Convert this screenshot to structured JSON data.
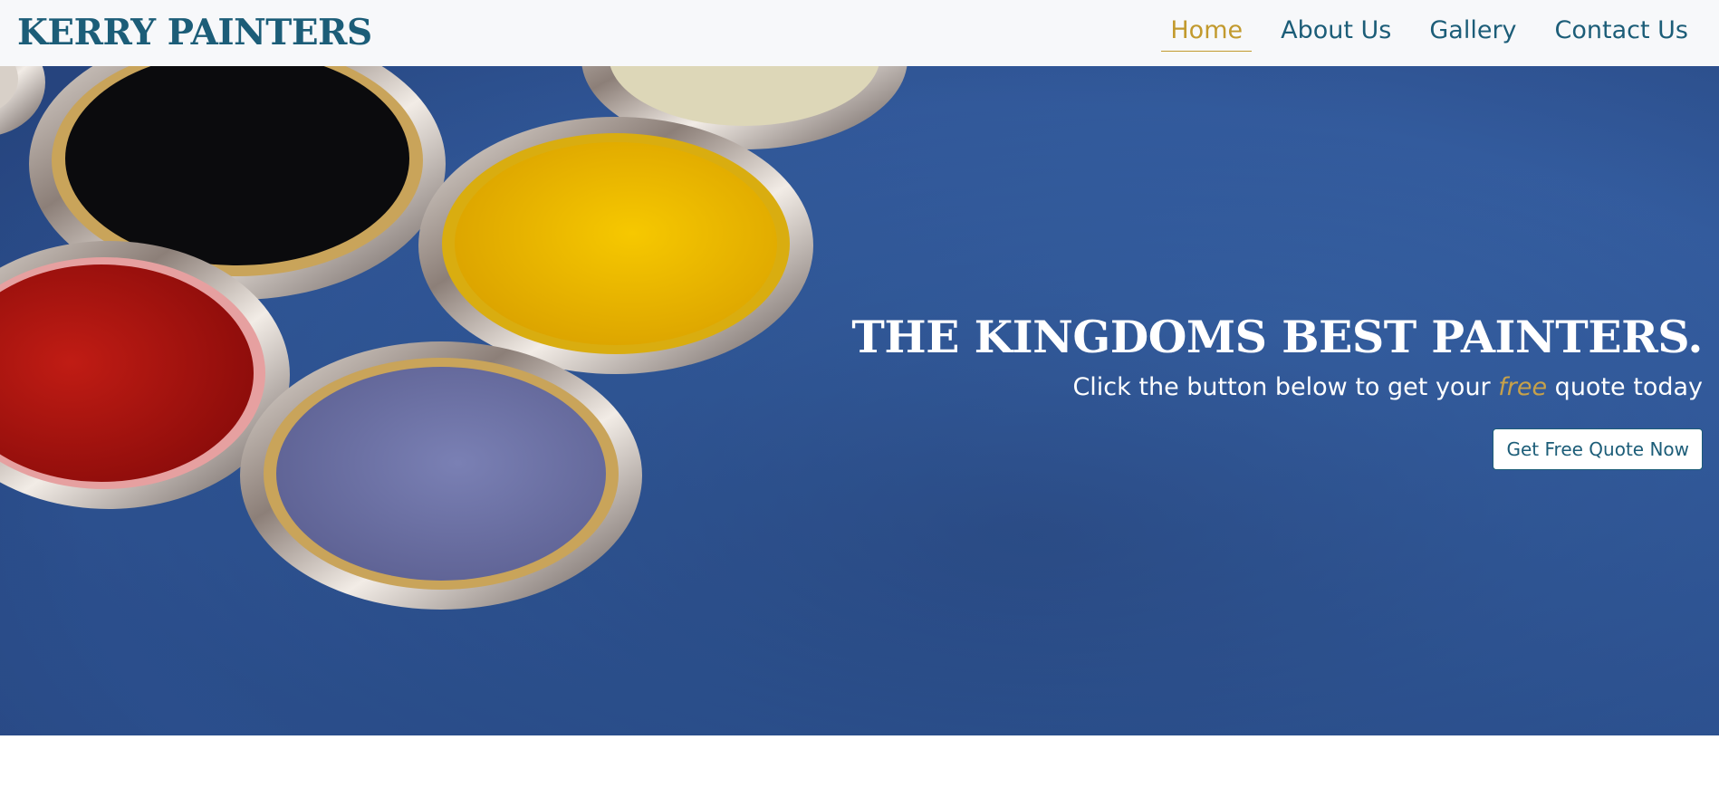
{
  "brand": {
    "name": "KERRY PAINTERS"
  },
  "nav": {
    "items": [
      {
        "label": "Home",
        "active": true
      },
      {
        "label": "About Us",
        "active": false
      },
      {
        "label": "Gallery",
        "active": false
      },
      {
        "label": "Contact Us",
        "active": false
      }
    ]
  },
  "hero": {
    "headline": "THE KINGDOMS BEST PAINTERS.",
    "sub_before": "Click the button below to get your ",
    "sub_accent": "free",
    "sub_after": " quote today",
    "button_label": "Get Free Quote Now",
    "image_description": ""
  },
  "colors": {
    "brand": "#1c5d78",
    "accent": "#c29a2e",
    "hero_bg": "#2f5796",
    "nav_bg": "#f7f8fa"
  }
}
